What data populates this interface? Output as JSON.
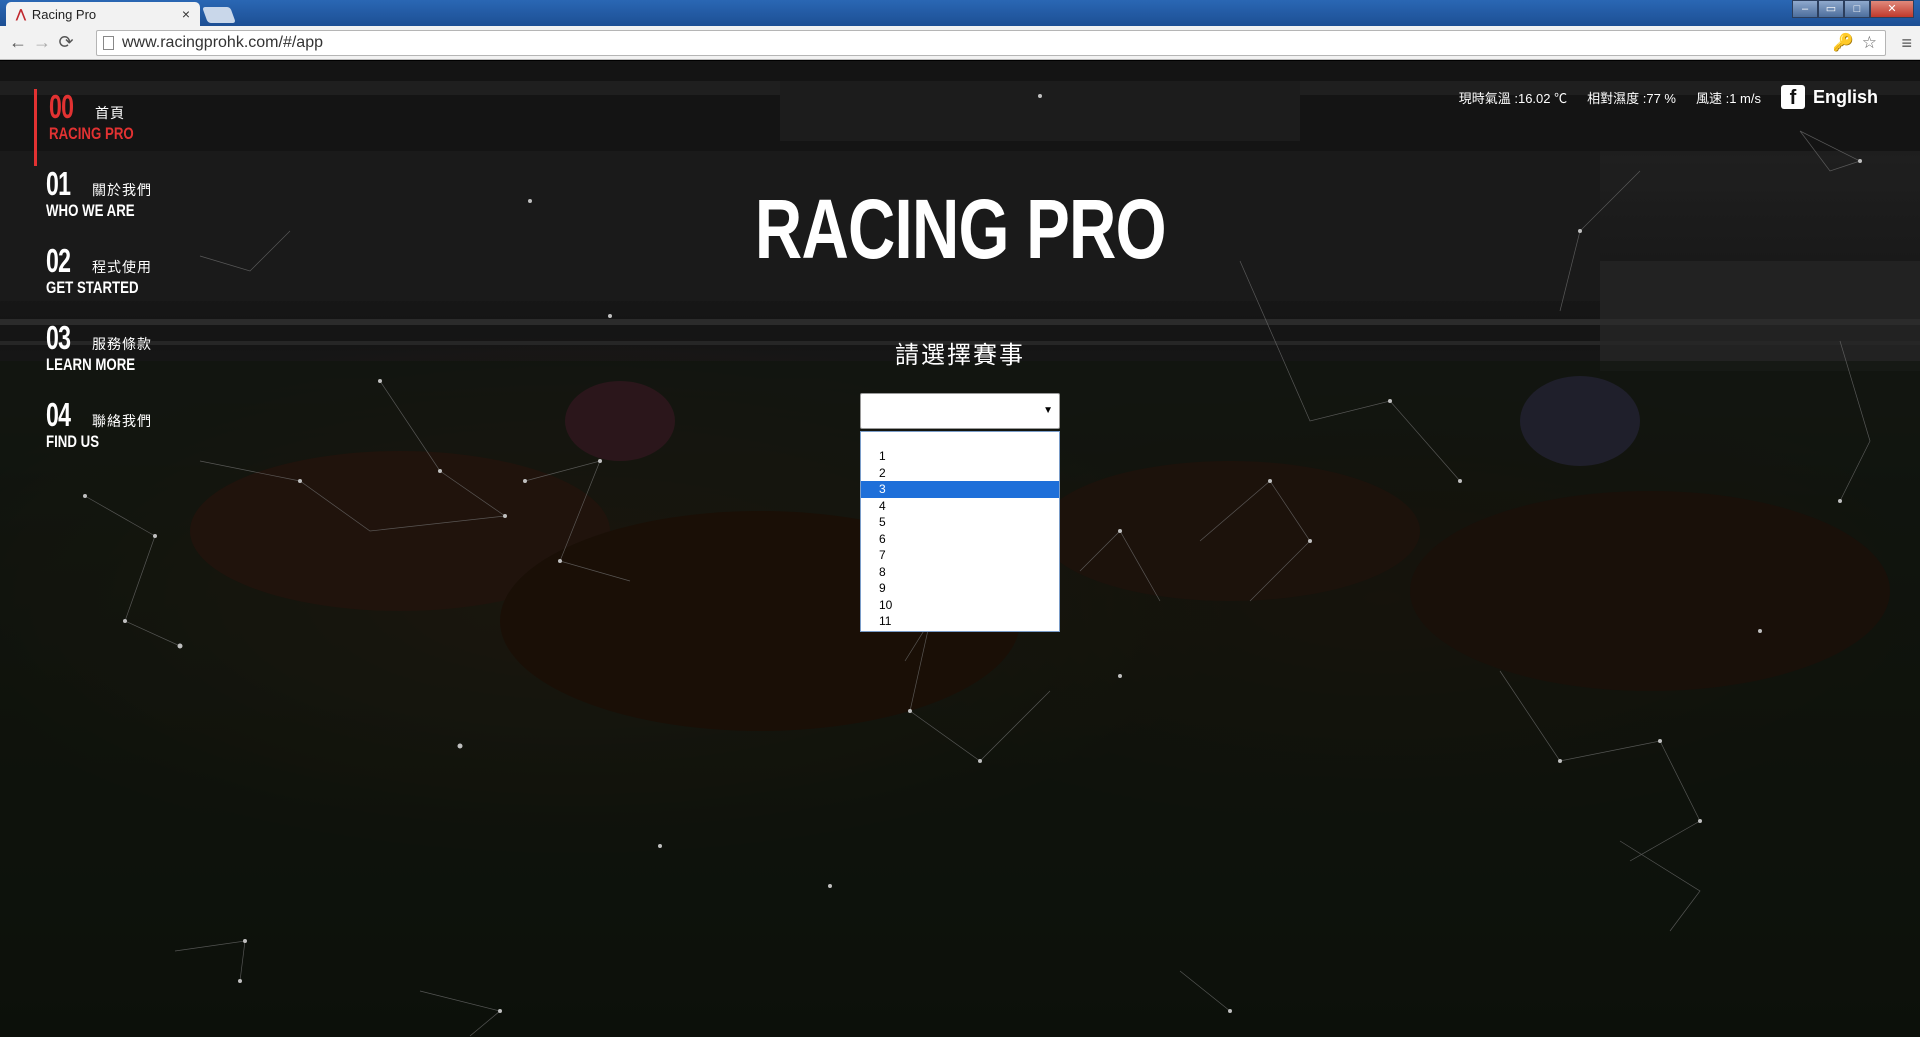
{
  "browser": {
    "tab_title": "Racing Pro",
    "tab_close": "×",
    "url": "www.racingprohk.com/#/app",
    "back": "←",
    "forward": "→",
    "reload": "⟳",
    "menu": "≡",
    "key_icon": "🔑",
    "star_icon": "☆",
    "window_controls": {
      "minimize": "–",
      "restore": "▭",
      "maximize": "□",
      "close": "✕"
    }
  },
  "nav": [
    {
      "num": "00",
      "cn": "首頁",
      "en": "RACING PRO",
      "active": true
    },
    {
      "num": "01",
      "cn": "關於我們",
      "en": "WHO WE ARE"
    },
    {
      "num": "02",
      "cn": "程式使用",
      "en": "GET STARTED"
    },
    {
      "num": "03",
      "cn": "服務條款",
      "en": "LEARN MORE"
    },
    {
      "num": "04",
      "cn": "聯絡我們",
      "en": "FIND US"
    }
  ],
  "weather": {
    "temperature": "現時氣溫 :16.02 ℃",
    "humidity": "相對濕度 :77 %",
    "wind": "風速 :1 m/s"
  },
  "facebook_icon": "f",
  "language": "English",
  "hero": {
    "title": "RACING PRO",
    "prompt": "請選擇賽事"
  },
  "race_select": {
    "value": "",
    "arrow": "▼",
    "options": [
      "",
      "1",
      "2",
      "3",
      "4",
      "5",
      "6",
      "7",
      "8",
      "9",
      "10",
      "11"
    ],
    "highlighted": "3"
  },
  "colors": {
    "accent": "#e23232",
    "highlight": "#1e6fd9"
  }
}
